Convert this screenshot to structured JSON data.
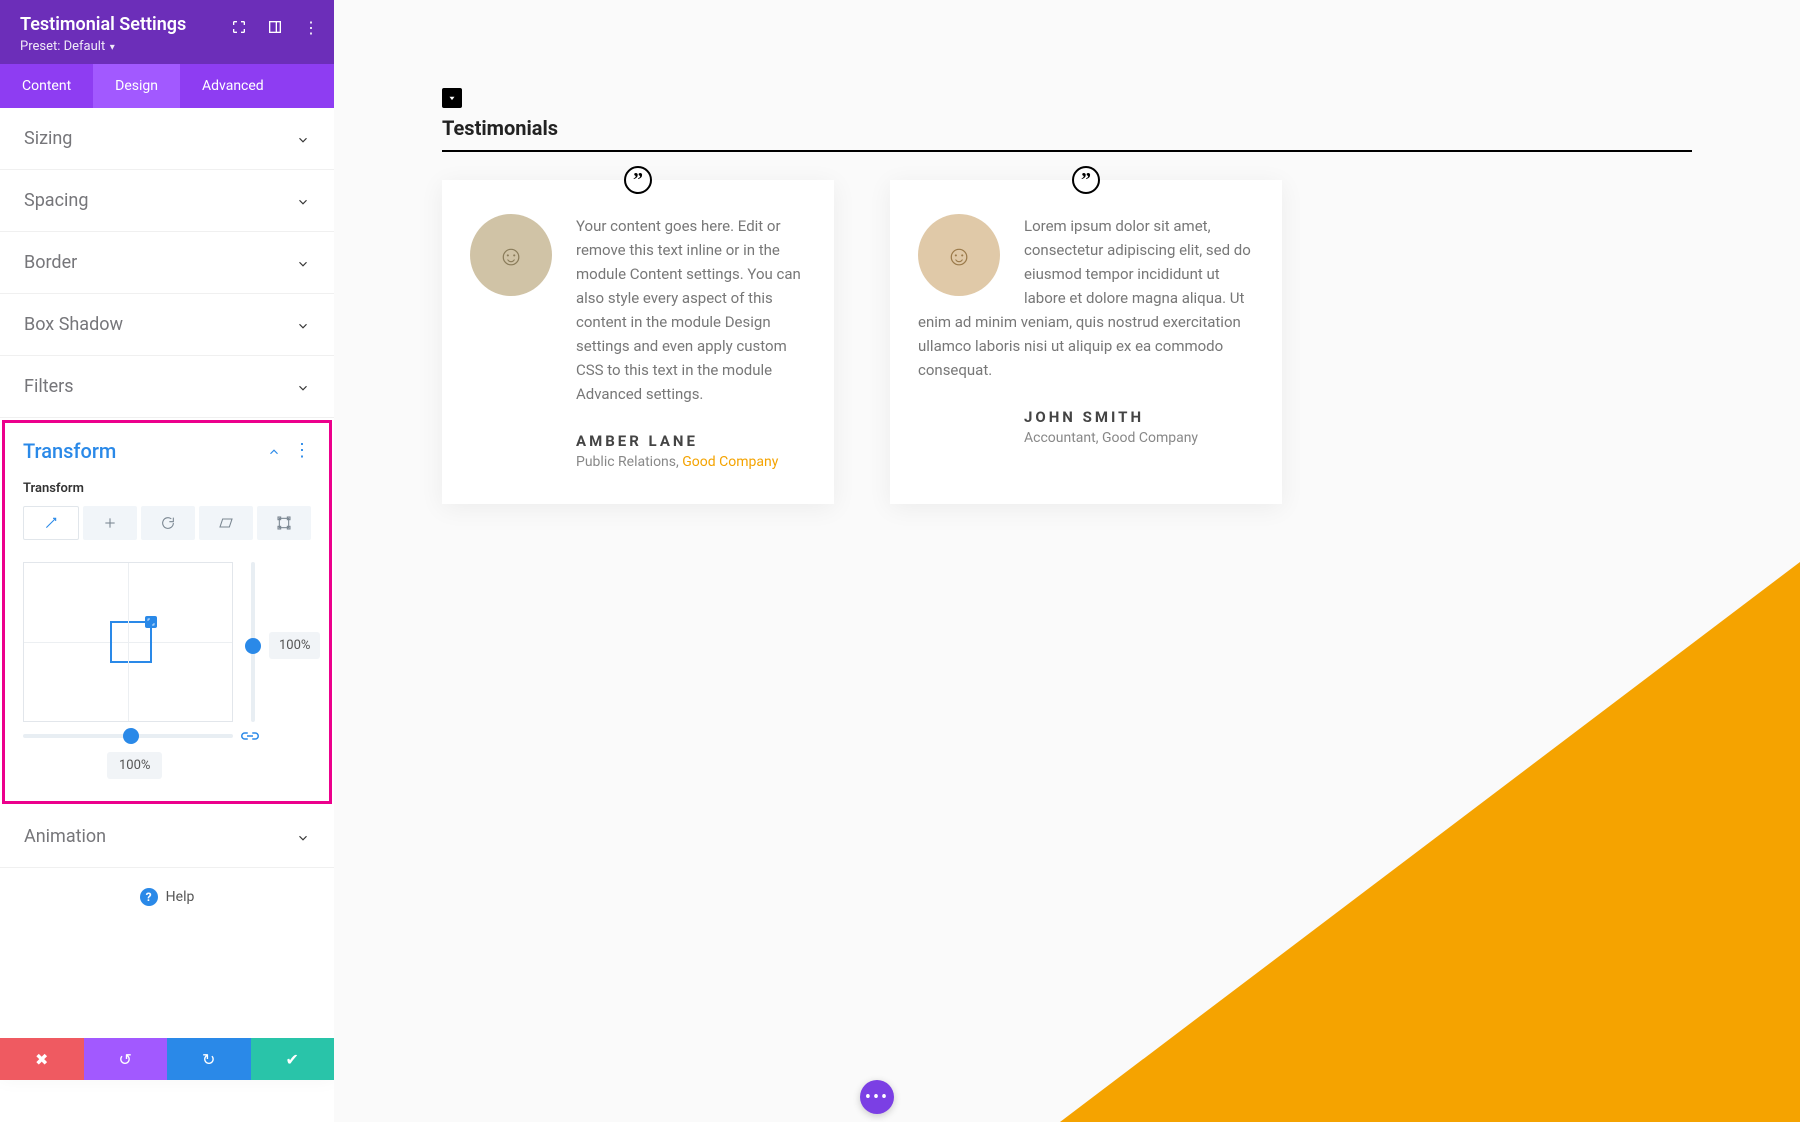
{
  "panel": {
    "title": "Testimonial Settings",
    "preset_label": "Preset: Default",
    "tabs": {
      "content": "Content",
      "design": "Design",
      "advanced": "Advanced"
    },
    "sections": {
      "sizing": "Sizing",
      "spacing": "Spacing",
      "border": "Border",
      "box_shadow": "Box Shadow",
      "filters": "Filters",
      "animation": "Animation"
    },
    "transform": {
      "title": "Transform",
      "sub_label": "Transform",
      "v_value": "100%",
      "h_value": "100%"
    },
    "help": "Help"
  },
  "page": {
    "section_title": "Testimonials",
    "testimonials": [
      {
        "text": "Your content goes here. Edit or remove this text inline or in the module Content settings. You can also style every aspect of this content in the module Design settings and even apply custom CSS to this text in the module Advanced settings.",
        "name": "AMBER LANE",
        "role": "Public Relations, ",
        "company": "Good Company",
        "company_is_link": true
      },
      {
        "text": "Lorem ipsum dolor sit amet, consectetur adipiscing elit, sed do eiusmod tempor incididunt ut labore et dolore magna aliqua. Ut enim ad minim veniam, quis nostrud exercitation ullamco laboris nisi ut aliquip ex ea commodo consequat.",
        "name": "JOHN SMITH",
        "role": "Accountant, ",
        "company": "Good Company",
        "company_is_link": false
      }
    ]
  },
  "colors": {
    "accent_purple": "#8e3df2",
    "highlight_pink": "#ec008c",
    "brand_orange": "#f5a300",
    "link_blue": "#2a89e8"
  }
}
